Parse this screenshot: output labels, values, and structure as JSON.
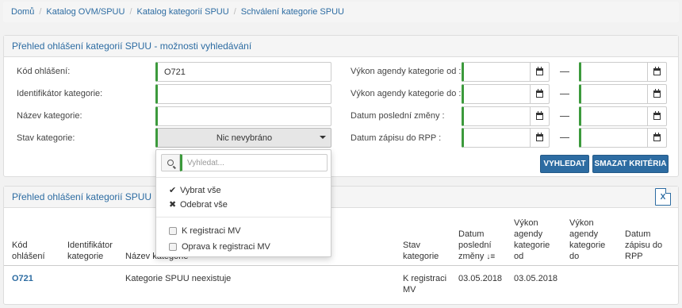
{
  "breadcrumb": [
    "Domů",
    "Katalog OVM/SPUU",
    "Katalog kategorií SPUU",
    "Schválení kategorie SPUU"
  ],
  "search_panel": {
    "title": "Přehled ohlášení kategorií SPUU - možnosti vyhledávání",
    "fields": {
      "kod_label": "Kód ohlášení:",
      "kod_value": "O721",
      "ident_label": "Identifikátor kategorie:",
      "ident_value": "",
      "nazev_label": "Název kategorie:",
      "nazev_value": "",
      "stav_label": "Stav kategorie:",
      "stav_value": "Nic nevybráno",
      "vykon_od_label": "Výkon agendy kategorie od :",
      "vykon_do_label": "Výkon agendy kategorie do :",
      "datum_zmeny_label": "Datum poslední změny :",
      "datum_zapisu_label": "Datum zápisu do RPP :"
    },
    "buttons": {
      "search": "VYHLEDAT",
      "clear": "SMAZAT KRITÉRIA"
    }
  },
  "dropdown": {
    "search_placeholder": "Vyhledat...",
    "select_all": "Vybrat vše",
    "deselect_all": "Odebrat vše",
    "options": [
      "K registraci MV",
      "Oprava k registraci MV"
    ]
  },
  "results": {
    "title": "Přehled ohlášení kategorií SPUU",
    "columns": {
      "kod": [
        "Kód",
        "ohlášení"
      ],
      "ident": [
        "Identifikátor",
        "kategorie"
      ],
      "nazev": [
        "Název kategorie"
      ],
      "stav": [
        "Stav",
        "kategorie"
      ],
      "zmena": [
        "Datum",
        "poslední",
        "změny"
      ],
      "vykon_od": [
        "Výkon",
        "agendy",
        "kategorie",
        "od"
      ],
      "vykon_do": [
        "Výkon",
        "agendy",
        "kategorie",
        "do"
      ],
      "zapis": [
        "Datum",
        "zápisu do",
        "RPP"
      ]
    },
    "rows": [
      {
        "kod": "O721",
        "ident": "",
        "nazev": "Kategorie SPUU neexistuje",
        "stav": [
          "K registraci",
          "MV"
        ],
        "zmena": "03.05.2018",
        "vykon_od": "03.05.2018",
        "vykon_do": "",
        "zapis": ""
      }
    ]
  },
  "icons": {
    "calendar": "calendar-icon",
    "search": "search-icon",
    "check": "check-icon",
    "times": "times-icon",
    "sort": "sort-desc-icon",
    "excel": "excel-export-icon"
  },
  "colors": {
    "primary": "#2d6ca2",
    "accent_green": "#3c9a3c"
  }
}
